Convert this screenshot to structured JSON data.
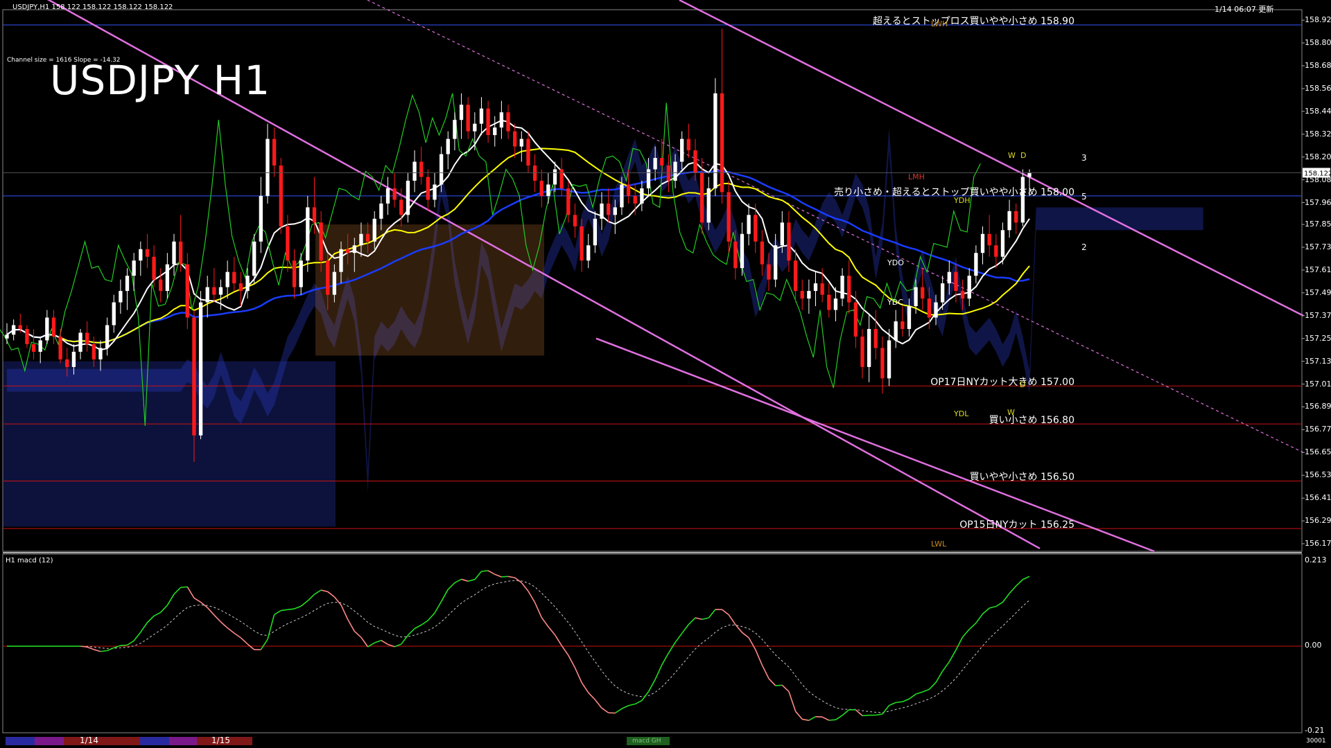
{
  "header": {
    "symbol_info": "USDJPY,H1  158.122 158.122 158.122 158.122",
    "datetime": "1/14 06:07 更新",
    "channel_info": "Channel size = 1616 Slope = -14.32",
    "title": "USDJPY H1"
  },
  "price_axis": {
    "ticks": [
      "158.925",
      "158.805",
      "158.685",
      "158.565",
      "158.445",
      "158.325",
      "158.205",
      "158.085",
      "157.965",
      "157.850",
      "157.730",
      "157.610",
      "157.490",
      "157.370",
      "157.250",
      "157.130",
      "157.010",
      "156.890",
      "156.770",
      "156.650",
      "156.530",
      "156.410",
      "156.290",
      "156.170"
    ],
    "current_price": "158.122"
  },
  "levels": [
    {
      "text": "超えるとストップロス買いやや小さめ 158.90",
      "price": 158.9,
      "color": "#3355ff"
    },
    {
      "text": "売り小さめ・超えるとストップ買いやや小さめ 158.00",
      "price": 158.0,
      "color": "#3355ff"
    },
    {
      "text": "OP17日NYカット大きめ 157.00",
      "price": 157.0,
      "color": "#cc1111"
    },
    {
      "text": "買い小さめ 156.80",
      "price": 156.8,
      "color": "#cc1111"
    },
    {
      "text": "買いやや小さめ 156.50",
      "price": 156.5,
      "color": "#cc1111"
    },
    {
      "text": "OP15日NYカット 156.25",
      "price": 156.25,
      "color": "#cc1111"
    }
  ],
  "box_labels": {
    "lwh": "LWH",
    "lmh": "LMH",
    "ydh": "YDH",
    "ydo": "YDO",
    "ydc": "YDC",
    "ydl": "YDL",
    "lwl": "LWL",
    "w_top": "W",
    "d_top": "D",
    "d_low": "D",
    "w_low": "W"
  },
  "channel_labels": [
    "3",
    "5",
    "2"
  ],
  "macd": {
    "label": "H1  macd (12)",
    "ticks": [
      "0.213",
      "0.00",
      "-0.21"
    ]
  },
  "bottom_bar": {
    "dates": [
      "1/14",
      "1/15"
    ],
    "tab_label": "macd GH",
    "right_label": "30001"
  },
  "colors": {
    "background": "#000000",
    "bull": "#ffffff",
    "bear": "#ff1a1a",
    "channel": "#e070e0",
    "ma_white": "#ffffff",
    "ma_yellow": "#ffff00",
    "ma_blue": "#1a3cff",
    "cloud_blue": "#2a3cc8",
    "cloud_orange": "#c87832",
    "chikou_green": "#22cc22",
    "macd_green": "#22dd22",
    "macd_pink": "#ff8888"
  },
  "chart_data": {
    "type": "candlestick",
    "title": "USDJPY H1",
    "ylim": [
      156.13,
      158.98
    ],
    "candles": [
      [
        157.25,
        157.33,
        157.22,
        157.27
      ],
      [
        157.27,
        157.35,
        157.24,
        157.32
      ],
      [
        157.32,
        157.38,
        157.28,
        157.3
      ],
      [
        157.3,
        157.32,
        157.2,
        157.22
      ],
      [
        157.22,
        157.3,
        157.14,
        157.18
      ],
      [
        157.18,
        157.26,
        157.12,
        157.24
      ],
      [
        157.24,
        157.4,
        157.22,
        157.36
      ],
      [
        157.36,
        157.4,
        157.22,
        157.26
      ],
      [
        157.26,
        157.3,
        157.12,
        157.14
      ],
      [
        157.14,
        157.2,
        157.05,
        157.1
      ],
      [
        157.1,
        157.22,
        157.06,
        157.18
      ],
      [
        157.18,
        157.3,
        157.14,
        157.28
      ],
      [
        157.28,
        157.34,
        157.18,
        157.22
      ],
      [
        157.22,
        157.26,
        157.1,
        157.14
      ],
      [
        157.14,
        157.24,
        157.08,
        157.2
      ],
      [
        157.2,
        157.36,
        157.16,
        157.32
      ],
      [
        157.32,
        157.48,
        157.28,
        157.44
      ],
      [
        157.44,
        157.56,
        157.38,
        157.5
      ],
      [
        157.5,
        157.62,
        157.4,
        157.58
      ],
      [
        157.58,
        157.7,
        157.5,
        157.66
      ],
      [
        157.66,
        157.76,
        157.58,
        157.72
      ],
      [
        157.72,
        157.8,
        157.62,
        157.68
      ],
      [
        157.68,
        157.74,
        157.52,
        157.56
      ],
      [
        157.56,
        157.62,
        157.44,
        157.5
      ],
      [
        157.5,
        157.7,
        157.46,
        157.64
      ],
      [
        157.64,
        157.8,
        157.58,
        157.76
      ],
      [
        157.76,
        157.9,
        157.6,
        157.64
      ],
      [
        157.64,
        157.7,
        157.3,
        157.36
      ],
      [
        157.36,
        157.4,
        156.6,
        156.74
      ],
      [
        156.74,
        157.5,
        156.72,
        157.44
      ],
      [
        157.44,
        157.58,
        157.36,
        157.52
      ],
      [
        157.52,
        157.62,
        157.44,
        157.48
      ],
      [
        157.48,
        157.56,
        157.4,
        157.52
      ],
      [
        157.52,
        157.66,
        157.46,
        157.6
      ],
      [
        157.6,
        157.68,
        157.5,
        157.54
      ],
      [
        157.54,
        157.6,
        157.42,
        157.5
      ],
      [
        157.5,
        157.62,
        157.46,
        157.58
      ],
      [
        157.58,
        157.8,
        157.54,
        157.76
      ],
      [
        157.76,
        158.1,
        157.7,
        158.0
      ],
      [
        158.0,
        158.38,
        157.96,
        158.3
      ],
      [
        158.3,
        158.36,
        158.1,
        158.16
      ],
      [
        158.16,
        158.2,
        157.8,
        157.84
      ],
      [
        157.84,
        157.9,
        157.6,
        157.66
      ],
      [
        157.66,
        157.72,
        157.46,
        157.52
      ],
      [
        157.52,
        157.7,
        157.48,
        157.66
      ],
      [
        157.66,
        158.0,
        157.6,
        157.94
      ],
      [
        157.94,
        158.1,
        157.8,
        157.86
      ],
      [
        157.86,
        157.92,
        157.6,
        157.66
      ],
      [
        157.66,
        157.7,
        157.4,
        157.48
      ],
      [
        157.48,
        157.64,
        157.44,
        157.6
      ],
      [
        157.6,
        157.76,
        157.54,
        157.72
      ],
      [
        157.72,
        157.8,
        157.64,
        157.7
      ],
      [
        157.7,
        157.78,
        157.6,
        157.74
      ],
      [
        157.74,
        157.86,
        157.68,
        157.8
      ],
      [
        157.8,
        157.86,
        157.7,
        157.76
      ],
      [
        157.76,
        157.92,
        157.72,
        157.88
      ],
      [
        157.88,
        158.0,
        157.82,
        157.96
      ],
      [
        157.96,
        158.1,
        157.9,
        158.04
      ],
      [
        158.04,
        158.12,
        157.94,
        157.98
      ],
      [
        157.98,
        158.04,
        157.84,
        157.9
      ],
      [
        157.9,
        158.12,
        157.86,
        158.08
      ],
      [
        158.08,
        158.24,
        158.02,
        158.18
      ],
      [
        158.18,
        158.26,
        158.06,
        158.1
      ],
      [
        158.1,
        158.14,
        157.92,
        157.98
      ],
      [
        157.98,
        158.12,
        157.94,
        158.06
      ],
      [
        158.06,
        158.26,
        158.02,
        158.22
      ],
      [
        158.22,
        158.34,
        158.14,
        158.3
      ],
      [
        158.3,
        158.44,
        158.24,
        158.4
      ],
      [
        158.4,
        158.54,
        158.3,
        158.48
      ],
      [
        158.48,
        158.52,
        158.3,
        158.34
      ],
      [
        158.34,
        158.44,
        158.24,
        158.38
      ],
      [
        158.38,
        158.52,
        158.32,
        158.46
      ],
      [
        158.46,
        158.5,
        158.28,
        158.32
      ],
      [
        158.32,
        158.42,
        158.26,
        158.36
      ],
      [
        158.36,
        158.5,
        158.3,
        158.44
      ],
      [
        158.44,
        158.48,
        158.3,
        158.34
      ],
      [
        158.34,
        158.38,
        158.2,
        158.26
      ],
      [
        158.26,
        158.34,
        158.18,
        158.3
      ],
      [
        158.3,
        158.34,
        158.12,
        158.16
      ],
      [
        158.16,
        158.22,
        158.02,
        158.08
      ],
      [
        158.08,
        158.14,
        157.94,
        158.0
      ],
      [
        158.0,
        158.12,
        157.96,
        158.06
      ],
      [
        158.06,
        158.18,
        158.02,
        158.14
      ],
      [
        158.14,
        158.2,
        158.0,
        158.04
      ],
      [
        158.04,
        158.08,
        157.86,
        157.9
      ],
      [
        157.9,
        157.96,
        157.78,
        157.84
      ],
      [
        157.84,
        157.88,
        157.6,
        157.66
      ],
      [
        157.66,
        157.8,
        157.62,
        157.74
      ],
      [
        157.74,
        157.92,
        157.7,
        157.88
      ],
      [
        157.88,
        158.02,
        157.82,
        157.96
      ],
      [
        157.96,
        158.04,
        157.86,
        157.9
      ],
      [
        157.9,
        157.98,
        157.8,
        157.94
      ],
      [
        157.94,
        158.1,
        157.9,
        158.06
      ],
      [
        158.06,
        158.14,
        157.96,
        158.0
      ],
      [
        158.0,
        158.06,
        157.9,
        157.96
      ],
      [
        157.96,
        158.08,
        157.92,
        158.04
      ],
      [
        158.04,
        158.2,
        158.0,
        158.14
      ],
      [
        158.14,
        158.26,
        158.08,
        158.2
      ],
      [
        158.2,
        158.3,
        158.12,
        158.16
      ],
      [
        158.16,
        158.22,
        158.02,
        158.08
      ],
      [
        158.08,
        158.22,
        158.04,
        158.18
      ],
      [
        158.18,
        158.34,
        158.14,
        158.3
      ],
      [
        158.3,
        158.38,
        158.2,
        158.24
      ],
      [
        158.24,
        158.3,
        158.08,
        158.12
      ],
      [
        158.12,
        158.2,
        157.8,
        157.86
      ],
      [
        157.86,
        158.1,
        157.82,
        158.04
      ],
      [
        158.04,
        158.62,
        158.0,
        158.54
      ],
      [
        158.54,
        158.88,
        157.96,
        158.02
      ],
      [
        158.02,
        158.08,
        157.7,
        157.76
      ],
      [
        157.76,
        157.82,
        157.56,
        157.62
      ],
      [
        157.62,
        157.86,
        157.58,
        157.8
      ],
      [
        157.8,
        157.96,
        157.74,
        157.9
      ],
      [
        157.9,
        157.96,
        157.7,
        157.76
      ],
      [
        157.76,
        157.82,
        157.58,
        157.64
      ],
      [
        157.64,
        157.7,
        157.5,
        157.56
      ],
      [
        157.56,
        157.8,
        157.52,
        157.74
      ],
      [
        157.74,
        157.92,
        157.7,
        157.86
      ],
      [
        157.86,
        157.92,
        157.6,
        157.66
      ],
      [
        157.66,
        157.72,
        157.44,
        157.5
      ],
      [
        157.5,
        157.56,
        157.4,
        157.46
      ],
      [
        157.46,
        157.56,
        157.38,
        157.5
      ],
      [
        157.5,
        157.6,
        157.42,
        157.54
      ],
      [
        157.54,
        157.62,
        157.44,
        157.48
      ],
      [
        157.48,
        157.54,
        157.36,
        157.4
      ],
      [
        157.4,
        157.52,
        157.34,
        157.46
      ],
      [
        157.46,
        157.62,
        157.42,
        157.58
      ],
      [
        157.58,
        157.66,
        157.38,
        157.44
      ],
      [
        157.44,
        157.5,
        157.2,
        157.26
      ],
      [
        157.26,
        157.3,
        157.04,
        157.1
      ],
      [
        157.1,
        157.38,
        157.02,
        157.3
      ],
      [
        157.3,
        157.4,
        157.14,
        157.2
      ],
      [
        157.2,
        157.26,
        156.96,
        157.04
      ],
      [
        157.04,
        157.3,
        157.0,
        157.24
      ],
      [
        157.24,
        157.4,
        157.2,
        157.34
      ],
      [
        157.34,
        157.42,
        157.26,
        157.3
      ],
      [
        157.3,
        157.46,
        157.26,
        157.42
      ],
      [
        157.42,
        157.56,
        157.38,
        157.52
      ],
      [
        157.52,
        157.62,
        157.4,
        157.46
      ],
      [
        157.46,
        157.52,
        157.3,
        157.36
      ],
      [
        157.36,
        157.48,
        157.32,
        157.44
      ],
      [
        157.44,
        157.58,
        157.4,
        157.54
      ],
      [
        157.54,
        157.66,
        157.48,
        157.6
      ],
      [
        157.6,
        157.64,
        157.44,
        157.5
      ],
      [
        157.5,
        157.56,
        157.4,
        157.46
      ],
      [
        157.46,
        157.62,
        157.42,
        157.58
      ],
      [
        157.58,
        157.74,
        157.54,
        157.7
      ],
      [
        157.7,
        157.84,
        157.64,
        157.8
      ],
      [
        157.8,
        157.9,
        157.68,
        157.74
      ],
      [
        157.74,
        157.8,
        157.62,
        157.68
      ],
      [
        157.68,
        157.86,
        157.64,
        157.82
      ],
      [
        157.82,
        157.98,
        157.78,
        157.92
      ],
      [
        157.92,
        157.96,
        157.8,
        157.86
      ],
      [
        157.86,
        158.14,
        157.84,
        158.1
      ],
      [
        158.1,
        158.14,
        158.0,
        158.12
      ]
    ]
  }
}
